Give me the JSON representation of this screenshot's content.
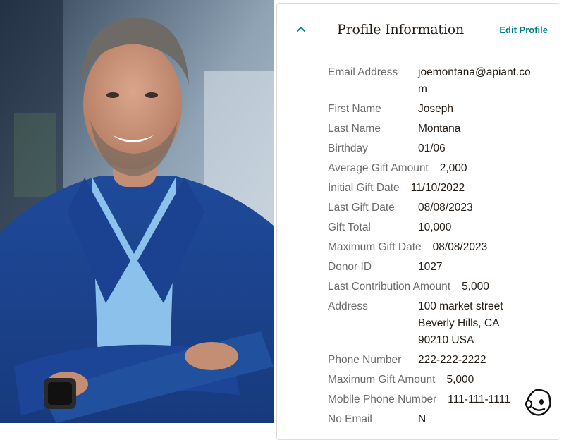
{
  "header": {
    "title": "Profile Information",
    "edit_label": "Edit Profile"
  },
  "fields": [
    {
      "label": "Email Address",
      "value": "joemontana@apiant.com"
    },
    {
      "label": "First Name",
      "value": "Joseph"
    },
    {
      "label": "Last Name",
      "value": "Montana"
    },
    {
      "label": "Birthday",
      "value": "01/06"
    },
    {
      "label": "Average Gift Amount",
      "value": "2,000"
    },
    {
      "label": "Initial Gift Date",
      "value": "11/10/2022"
    },
    {
      "label": "Last Gift Date",
      "value": "08/08/2023"
    },
    {
      "label": "Gift Total",
      "value": "10,000"
    },
    {
      "label": "Maximum Gift Date",
      "value": "08/08/2023"
    },
    {
      "label": "Donor ID",
      "value": "1027"
    },
    {
      "label": "Last Contribution Amount",
      "value": "5,000"
    },
    {
      "label": "Address",
      "value_lines": [
        "100 market street",
        "Beverly Hills, CA",
        "90210 USA"
      ]
    },
    {
      "label": "Phone Number",
      "value": "222-222-2222"
    },
    {
      "label": "Maximum Gift Amount",
      "value": "5,000"
    },
    {
      "label": "Mobile Phone Number",
      "value": "111-111-1111"
    },
    {
      "label": "No Email",
      "value": "N"
    }
  ],
  "icons": {
    "collapse": "chevron-up-icon",
    "brand": "mailchimp-logo-icon"
  },
  "colors": {
    "accent": "#007c89",
    "label": "#6b6b6b",
    "value": "#241c15"
  }
}
